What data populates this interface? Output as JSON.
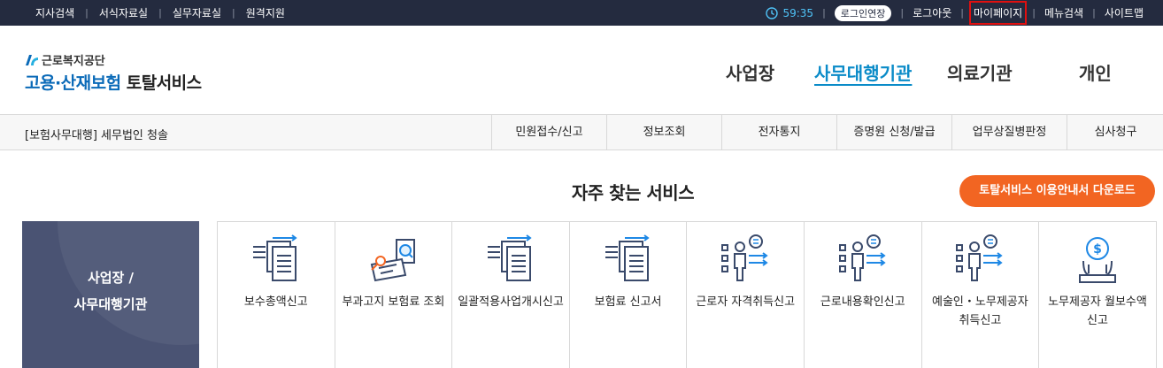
{
  "topbar": {
    "left_links": [
      "지사검색",
      "서식자료실",
      "실무자료실",
      "원격지원"
    ],
    "timer": "59:35",
    "extend_login": "로그인연장",
    "logout": "로그아웃",
    "mypage": "마이페이지",
    "menu_search": "메뉴검색",
    "sitemap": "사이트맵"
  },
  "header": {
    "org_name": "근로복지공단",
    "service_blue": "고용·산재보험",
    "service_dark": "토탈서비스",
    "nav": [
      "사업장",
      "사무대행기관",
      "의료기관",
      "개인"
    ],
    "active_nav": "사무대행기관"
  },
  "subnav": {
    "org_label": "[보험사무대행] 세무법인 청솔",
    "menus": [
      "민원접수/신고",
      "정보조회",
      "전자통지",
      "증명원 신청/발급",
      "업무상질병판정",
      "심사청구"
    ]
  },
  "main": {
    "section_title": "자주 찾는 서비스",
    "download_button": "토탈서비스 이용안내서 다운로드",
    "category": [
      "사업장 /",
      "사무대행기관"
    ],
    "services": [
      {
        "label": "보수총액신고",
        "icon": "document-arrows-icon"
      },
      {
        "label": "부과고지 보험료 조회",
        "icon": "document-search-icon"
      },
      {
        "label": "일괄적용사업개시신고",
        "icon": "document-arrows-icon"
      },
      {
        "label": "보험료 신고서",
        "icon": "document-arrows-icon"
      },
      {
        "label": "근로자 자격취득신고",
        "icon": "person-list-icon"
      },
      {
        "label": "근로내용확인신고",
        "icon": "person-list-icon"
      },
      {
        "label": "예술인・노무제공자 취득신고",
        "icon": "person-list-icon"
      },
      {
        "label": "노무제공자 월보수액 신고",
        "icon": "money-bag-icon"
      }
    ]
  },
  "colors": {
    "topbar_bg": "#242b3f",
    "accent_blue": "#0a8bc8",
    "orange": "#f26522",
    "category_bg": "#4a5373",
    "icon_navy": "#3a4a6b",
    "icon_blue": "#1e88e5"
  }
}
